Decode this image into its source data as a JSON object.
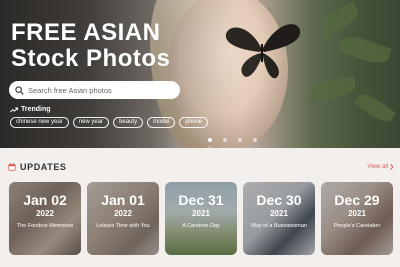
{
  "hero": {
    "title_line1": "FREE ASIAN",
    "title_line2": "Stock Photos",
    "search_placeholder": "Search free Asian photos",
    "trending_label": "Trending",
    "trending_tags": [
      "chinese new year",
      "new year",
      "beauty",
      "model",
      "phone"
    ],
    "carousel": {
      "slides": 4,
      "active_index": 0
    }
  },
  "updates": {
    "title": "UPDATES",
    "view_all": "View all",
    "cards": [
      {
        "date": "Jan 02",
        "year": "2022",
        "caption": "The Fondest Memories"
      },
      {
        "date": "Jan 01",
        "year": "2022",
        "caption": "Leisure Time with You"
      },
      {
        "date": "Dec 31",
        "year": "2021",
        "caption": "A Carefree Day"
      },
      {
        "date": "Dec 30",
        "year": "2021",
        "caption": "Way of a Businessman"
      },
      {
        "date": "Dec 29",
        "year": "2021",
        "caption": "People's Caretaker"
      }
    ]
  },
  "icons": {
    "search": "search-icon",
    "trending": "trending-up-icon",
    "updates": "calendar-icon",
    "view_all": "chevron-right-icon"
  },
  "colors": {
    "accent": "#e05a4f",
    "updates_title": "#333333",
    "page_bg": "#f2efec"
  }
}
